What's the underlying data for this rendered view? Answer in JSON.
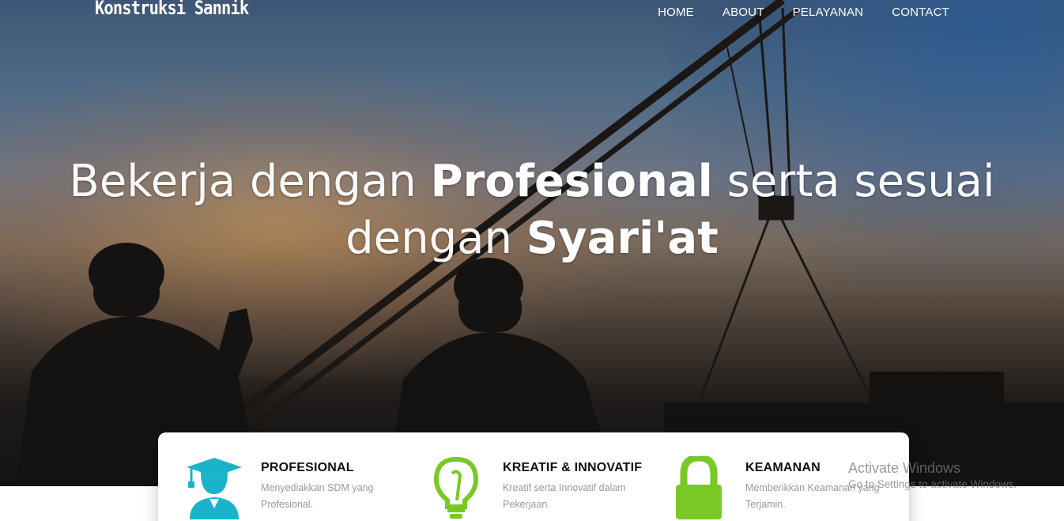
{
  "nav": {
    "brand": "Konstruksi Sannik",
    "items": [
      {
        "label": "HOME"
      },
      {
        "label": "ABOUT"
      },
      {
        "label": "PELAYANAN"
      },
      {
        "label": "CONTACT"
      }
    ]
  },
  "hero": {
    "line1_pre": "Bekerja dengan ",
    "line1_bold": "Profesional",
    "line1_post": " serta sesuai",
    "line2_pre": "dengan ",
    "line2_bold": "Syari'at"
  },
  "features": [
    {
      "title": "PROFESIONAL",
      "desc": "Menyediakkan SDM yang Profesional.",
      "icon": "graduate-icon",
      "color": "#1bb3c9"
    },
    {
      "title": "KREATIF & INNOVATIF",
      "desc": "Kreatif serta Innovatif dalam Pekerjaan.",
      "icon": "lightbulb-icon",
      "color": "#79c925"
    },
    {
      "title": "KEAMANAN",
      "desc": "Memberikkan Keamanan yang Terjamin.",
      "icon": "padlock-icon",
      "color": "#79c925"
    }
  ],
  "watermark": {
    "line1": "Activate Windows",
    "line2": "Go to Settings to activate Windows."
  }
}
